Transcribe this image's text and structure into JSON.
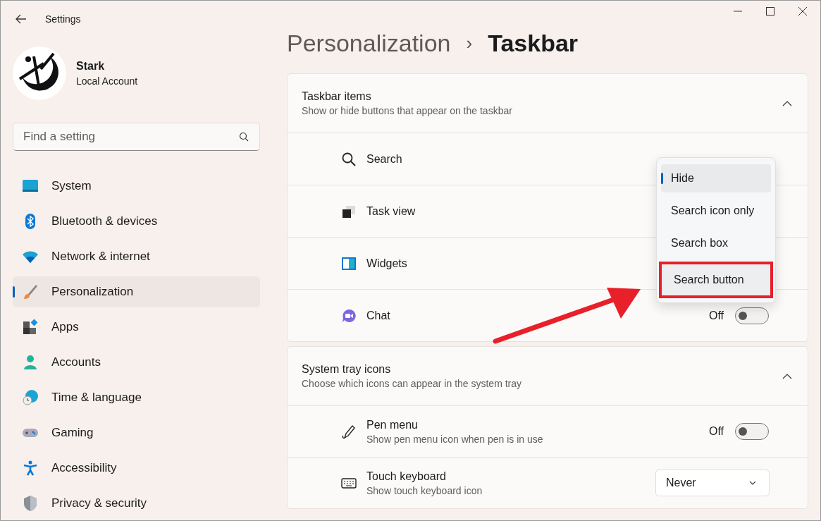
{
  "window": {
    "title": "Settings"
  },
  "profile": {
    "name": "Stark",
    "account": "Local Account"
  },
  "search": {
    "placeholder": "Find a setting"
  },
  "sidebar": {
    "items": [
      {
        "label": "System",
        "selected": false
      },
      {
        "label": "Bluetooth & devices",
        "selected": false
      },
      {
        "label": "Network & internet",
        "selected": false
      },
      {
        "label": "Personalization",
        "selected": true
      },
      {
        "label": "Apps",
        "selected": false
      },
      {
        "label": "Accounts",
        "selected": false
      },
      {
        "label": "Time & language",
        "selected": false
      },
      {
        "label": "Gaming",
        "selected": false
      },
      {
        "label": "Accessibility",
        "selected": false
      },
      {
        "label": "Privacy & security",
        "selected": false
      }
    ]
  },
  "breadcrumb": {
    "parent": "Personalization",
    "separator": "›",
    "current": "Taskbar"
  },
  "sections": [
    {
      "title": "Taskbar items",
      "subtitle": "Show or hide buttons that appear on the taskbar",
      "expanded": true,
      "rows": [
        {
          "label": "Search",
          "kind": "plain"
        },
        {
          "label": "Task view",
          "kind": "plain"
        },
        {
          "label": "Widgets",
          "kind": "plain"
        },
        {
          "label": "Chat",
          "kind": "toggle",
          "on": false,
          "state": "Off"
        }
      ]
    },
    {
      "title": "System tray icons",
      "subtitle": "Choose which icons can appear in the system tray",
      "expanded": true,
      "rows": [
        {
          "label": "Pen menu",
          "description": "Show pen menu icon when pen is in use",
          "kind": "toggle",
          "on": false,
          "state": "Off"
        },
        {
          "label": "Touch keyboard",
          "description": "Show touch keyboard icon",
          "kind": "dropdown",
          "value": "Never"
        }
      ]
    }
  ],
  "menu": {
    "items": [
      {
        "label": "Hide",
        "selected": true,
        "annotated": false
      },
      {
        "label": "Search icon only",
        "selected": false,
        "annotated": false
      },
      {
        "label": "Search box",
        "selected": false,
        "annotated": false
      },
      {
        "label": "Search button",
        "selected": false,
        "annotated": true
      }
    ]
  }
}
